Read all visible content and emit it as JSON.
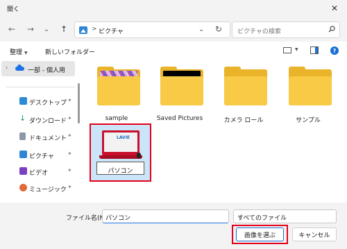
{
  "window": {
    "title": "開く",
    "close": "✕"
  },
  "nav": {
    "back": "←",
    "forward": "→",
    "history": "⌄",
    "up": "↑",
    "address": {
      "separator": ">",
      "location": "ピクチャ",
      "chevron": "⌄",
      "refresh": "↻"
    },
    "search_placeholder": "ピクチャの検索"
  },
  "toolbar": {
    "organize": "整理",
    "organize_dd": "▼",
    "new_folder": "新しいフォルダー",
    "view_dd": "▼",
    "help": "?"
  },
  "sidebar": {
    "top_item": {
      "chevron": "›",
      "label": "一部 - 個人用"
    },
    "items": [
      {
        "label": "デスクトップ",
        "pin": "✦",
        "icon": "desktop-icon",
        "color": "#2b8ad6"
      },
      {
        "label": "ダウンロード",
        "pin": "✦",
        "icon": "download-icon",
        "color": "#1a9a52"
      },
      {
        "label": "ドキュメント",
        "pin": "✦",
        "icon": "document-icon",
        "color": "#8a98a8"
      },
      {
        "label": "ピクチャ",
        "pin": "✦",
        "icon": "picture-icon",
        "color": "#2f86d6"
      },
      {
        "label": "ビデオ",
        "pin": "✦",
        "icon": "video-icon",
        "color": "#7a3fc4"
      },
      {
        "label": "ミュージック",
        "pin": "✦",
        "icon": "music-icon",
        "color": "#e06a3a"
      }
    ]
  },
  "files": [
    {
      "name": "sample",
      "icon": "folder-icon",
      "preview": "thumbnail"
    },
    {
      "name": "Saved Pictures",
      "icon": "folder-icon",
      "preview": "black"
    },
    {
      "name": "カメラ ロール",
      "icon": "folder-icon",
      "preview": "none"
    },
    {
      "name": "サンプル",
      "icon": "folder-icon",
      "preview": "none"
    },
    {
      "name": "パソコン",
      "icon": "laptop-image",
      "selected": true,
      "logo_text": "LAVIE"
    }
  ],
  "footer": {
    "filename_label": "ファイル名(N):",
    "filename_value": "パソコン",
    "filetype_value": "すべてのファイル",
    "filetype_chevron": "⌄",
    "open_button": "画像を選ぶ",
    "cancel_button": "キャンセル"
  },
  "colors": {
    "highlight": "#e3001b",
    "selection": "#cce4f7",
    "folder": "#f8ca45",
    "accent": "#1a6fd1"
  }
}
